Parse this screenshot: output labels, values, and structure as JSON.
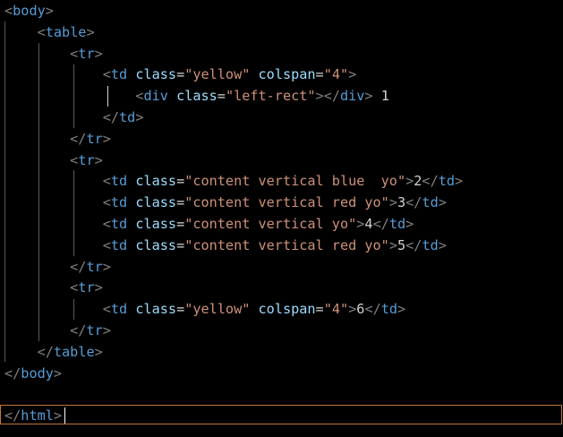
{
  "editor": {
    "language": "html",
    "cursor_line_text": "</html>",
    "colors": {
      "background": "#000000",
      "bracket": "#808080",
      "tag": "#569cd6",
      "attribute": "#9cdcfe",
      "string": "#ce9178",
      "text": "#d4d4d4",
      "indent_guide": "#5a5a5a",
      "cursor_line_border": "#c0763a"
    },
    "lines": [
      [
        {
          "t": "bracket",
          "v": "<"
        },
        {
          "t": "tag",
          "v": "body"
        },
        {
          "t": "bracket",
          "v": ">"
        }
      ],
      [
        {
          "t": "text",
          "v": "    "
        },
        {
          "t": "bracket",
          "v": "<"
        },
        {
          "t": "tag",
          "v": "table"
        },
        {
          "t": "bracket",
          "v": ">"
        }
      ],
      [
        {
          "t": "text",
          "v": "        "
        },
        {
          "t": "bracket",
          "v": "<"
        },
        {
          "t": "tag",
          "v": "tr"
        },
        {
          "t": "bracket",
          "v": ">"
        }
      ],
      [
        {
          "t": "text",
          "v": "            "
        },
        {
          "t": "bracket",
          "v": "<"
        },
        {
          "t": "tag",
          "v": "td"
        },
        {
          "t": "text",
          "v": " "
        },
        {
          "t": "attr",
          "v": "class"
        },
        {
          "t": "eq",
          "v": "="
        },
        {
          "t": "str",
          "v": "\"yellow\""
        },
        {
          "t": "text",
          "v": " "
        },
        {
          "t": "attr",
          "v": "colspan"
        },
        {
          "t": "eq",
          "v": "="
        },
        {
          "t": "str",
          "v": "\"4\""
        },
        {
          "t": "bracket",
          "v": ">"
        }
      ],
      [
        {
          "t": "text",
          "v": "                "
        },
        {
          "t": "bracket",
          "v": "<"
        },
        {
          "t": "tag",
          "v": "div"
        },
        {
          "t": "text",
          "v": " "
        },
        {
          "t": "attr",
          "v": "class"
        },
        {
          "t": "eq",
          "v": "="
        },
        {
          "t": "str",
          "v": "\"left-rect\""
        },
        {
          "t": "bracket",
          "v": "></"
        },
        {
          "t": "tag",
          "v": "div"
        },
        {
          "t": "bracket",
          "v": ">"
        },
        {
          "t": "text",
          "v": " 1"
        }
      ],
      [
        {
          "t": "text",
          "v": "            "
        },
        {
          "t": "bracket",
          "v": "</"
        },
        {
          "t": "tag",
          "v": "td"
        },
        {
          "t": "bracket",
          "v": ">"
        }
      ],
      [
        {
          "t": "text",
          "v": "        "
        },
        {
          "t": "bracket",
          "v": "</"
        },
        {
          "t": "tag",
          "v": "tr"
        },
        {
          "t": "bracket",
          "v": ">"
        }
      ],
      [
        {
          "t": "text",
          "v": "        "
        },
        {
          "t": "bracket",
          "v": "<"
        },
        {
          "t": "tag",
          "v": "tr"
        },
        {
          "t": "bracket",
          "v": ">"
        }
      ],
      [
        {
          "t": "text",
          "v": "            "
        },
        {
          "t": "bracket",
          "v": "<"
        },
        {
          "t": "tag",
          "v": "td"
        },
        {
          "t": "text",
          "v": " "
        },
        {
          "t": "attr",
          "v": "class"
        },
        {
          "t": "eq",
          "v": "="
        },
        {
          "t": "str",
          "v": "\"content vertical blue  yo\""
        },
        {
          "t": "bracket",
          "v": ">"
        },
        {
          "t": "text",
          "v": "2"
        },
        {
          "t": "bracket",
          "v": "</"
        },
        {
          "t": "tag",
          "v": "td"
        },
        {
          "t": "bracket",
          "v": ">"
        }
      ],
      [
        {
          "t": "text",
          "v": "            "
        },
        {
          "t": "bracket",
          "v": "<"
        },
        {
          "t": "tag",
          "v": "td"
        },
        {
          "t": "text",
          "v": " "
        },
        {
          "t": "attr",
          "v": "class"
        },
        {
          "t": "eq",
          "v": "="
        },
        {
          "t": "str",
          "v": "\"content vertical red yo\""
        },
        {
          "t": "bracket",
          "v": ">"
        },
        {
          "t": "text",
          "v": "3"
        },
        {
          "t": "bracket",
          "v": "</"
        },
        {
          "t": "tag",
          "v": "td"
        },
        {
          "t": "bracket",
          "v": ">"
        }
      ],
      [
        {
          "t": "text",
          "v": "            "
        },
        {
          "t": "bracket",
          "v": "<"
        },
        {
          "t": "tag",
          "v": "td"
        },
        {
          "t": "text",
          "v": " "
        },
        {
          "t": "attr",
          "v": "class"
        },
        {
          "t": "eq",
          "v": "="
        },
        {
          "t": "str",
          "v": "\"content vertical yo\""
        },
        {
          "t": "bracket",
          "v": ">"
        },
        {
          "t": "text",
          "v": "4"
        },
        {
          "t": "bracket",
          "v": "</"
        },
        {
          "t": "tag",
          "v": "td"
        },
        {
          "t": "bracket",
          "v": ">"
        }
      ],
      [
        {
          "t": "text",
          "v": "            "
        },
        {
          "t": "bracket",
          "v": "<"
        },
        {
          "t": "tag",
          "v": "td"
        },
        {
          "t": "text",
          "v": " "
        },
        {
          "t": "attr",
          "v": "class"
        },
        {
          "t": "eq",
          "v": "="
        },
        {
          "t": "str",
          "v": "\"content vertical red yo\""
        },
        {
          "t": "bracket",
          "v": ">"
        },
        {
          "t": "text",
          "v": "5"
        },
        {
          "t": "bracket",
          "v": "</"
        },
        {
          "t": "tag",
          "v": "td"
        },
        {
          "t": "bracket",
          "v": ">"
        }
      ],
      [
        {
          "t": "text",
          "v": "        "
        },
        {
          "t": "bracket",
          "v": "</"
        },
        {
          "t": "tag",
          "v": "tr"
        },
        {
          "t": "bracket",
          "v": ">"
        }
      ],
      [
        {
          "t": "text",
          "v": "        "
        },
        {
          "t": "bracket",
          "v": "<"
        },
        {
          "t": "tag",
          "v": "tr"
        },
        {
          "t": "bracket",
          "v": ">"
        }
      ],
      [
        {
          "t": "text",
          "v": "            "
        },
        {
          "t": "bracket",
          "v": "<"
        },
        {
          "t": "tag",
          "v": "td"
        },
        {
          "t": "text",
          "v": " "
        },
        {
          "t": "attr",
          "v": "class"
        },
        {
          "t": "eq",
          "v": "="
        },
        {
          "t": "str",
          "v": "\"yellow\""
        },
        {
          "t": "text",
          "v": " "
        },
        {
          "t": "attr",
          "v": "colspan"
        },
        {
          "t": "eq",
          "v": "="
        },
        {
          "t": "str",
          "v": "\"4\""
        },
        {
          "t": "bracket",
          "v": ">"
        },
        {
          "t": "text",
          "v": "6"
        },
        {
          "t": "bracket",
          "v": "</"
        },
        {
          "t": "tag",
          "v": "td"
        },
        {
          "t": "bracket",
          "v": ">"
        }
      ],
      [
        {
          "t": "text",
          "v": "        "
        },
        {
          "t": "bracket",
          "v": "</"
        },
        {
          "t": "tag",
          "v": "tr"
        },
        {
          "t": "bracket",
          "v": ">"
        }
      ],
      [
        {
          "t": "text",
          "v": "    "
        },
        {
          "t": "bracket",
          "v": "</"
        },
        {
          "t": "tag",
          "v": "table"
        },
        {
          "t": "bracket",
          "v": ">"
        }
      ],
      [
        {
          "t": "bracket",
          "v": "</"
        },
        {
          "t": "tag",
          "v": "body"
        },
        {
          "t": "bracket",
          "v": ">"
        }
      ],
      [],
      [
        {
          "t": "bracket",
          "v": "</"
        },
        {
          "t": "tag",
          "v": "html"
        },
        {
          "t": "bracket",
          "v": ">"
        }
      ]
    ]
  }
}
